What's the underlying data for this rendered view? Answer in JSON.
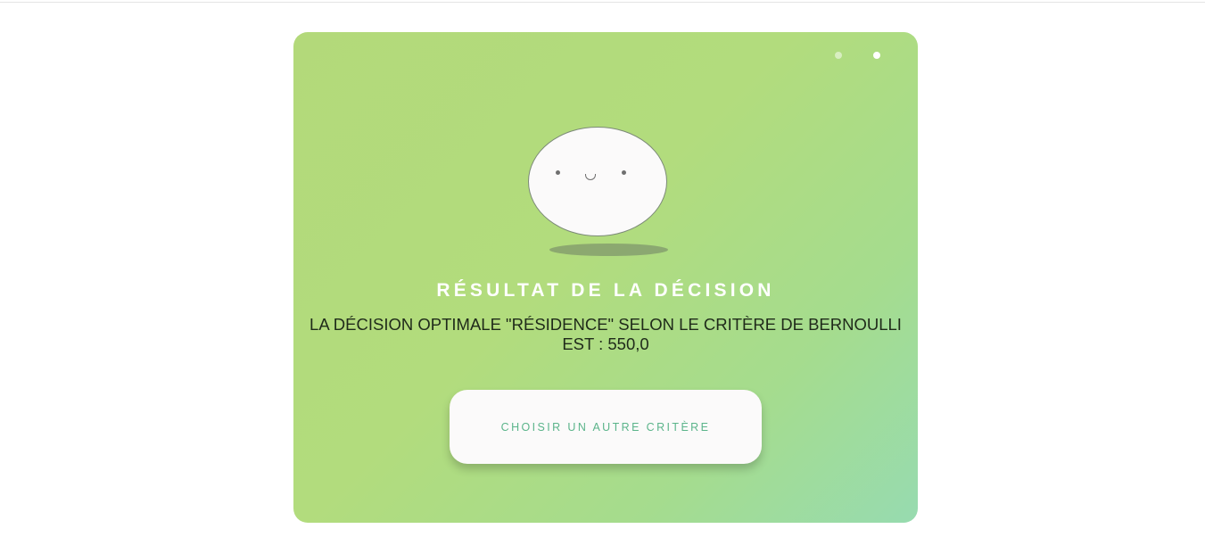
{
  "result": {
    "title": "RÉSULTAT DE LA DÉCISION",
    "message_line1": "LA DÉCISION OPTIMALE \"RÉSIDENCE\" SELON LE CRITÈRE DE BERNOULLI",
    "message_line2": "EST : 550,0",
    "button_label": "CHOISIR UN AUTRE CRITÈRE"
  },
  "pagination": {
    "total": 2,
    "active": 2
  },
  "illustration": {
    "icon": "smiling-face-icon"
  },
  "colors": {
    "card_gradient_start": "#b3d97a",
    "card_gradient_end": "#97dbb0",
    "title": "#ffffff",
    "button_text": "#5bb48a",
    "button_bg": "#fbfafa"
  }
}
